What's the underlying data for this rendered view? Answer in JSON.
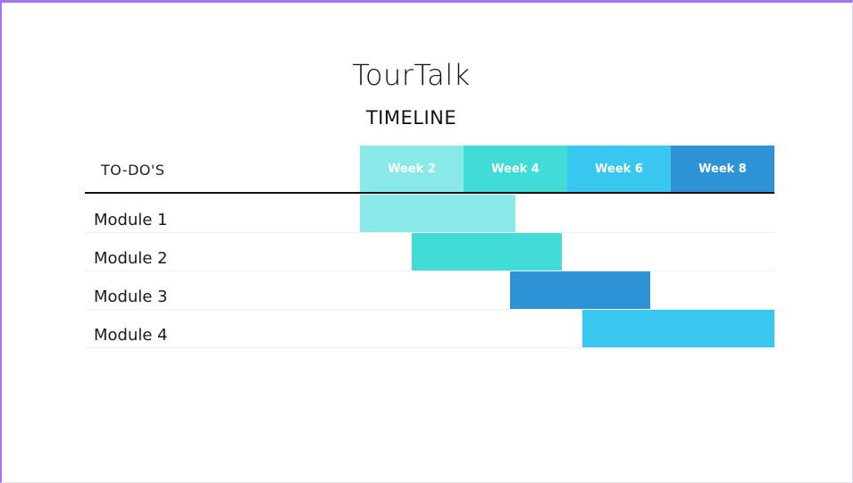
{
  "title": "TourTalk",
  "subtitle": "TIMELINE",
  "todo_header": "TO-DO'S",
  "weeks": [
    {
      "label": "Week 2",
      "color": "#89e8e8"
    },
    {
      "label": "Week 4",
      "color": "#41dcd8"
    },
    {
      "label": "Week 6",
      "color": "#3ac7ef"
    },
    {
      "label": "Week 8",
      "color": "#2e92d6"
    }
  ],
  "modules": [
    {
      "label": "Module 1",
      "start_week": 1.0,
      "end_week": 4.0,
      "color": "#89e8e8"
    },
    {
      "label": "Module 2",
      "start_week": 2.0,
      "end_week": 4.9,
      "color": "#41dcd8"
    },
    {
      "label": "Module 3",
      "start_week": 3.9,
      "end_week": 6.6,
      "color": "#2e92d6"
    },
    {
      "label": "Module 4",
      "start_week": 5.3,
      "end_week": 9.0,
      "color": "#3ac7ef"
    }
  ]
}
